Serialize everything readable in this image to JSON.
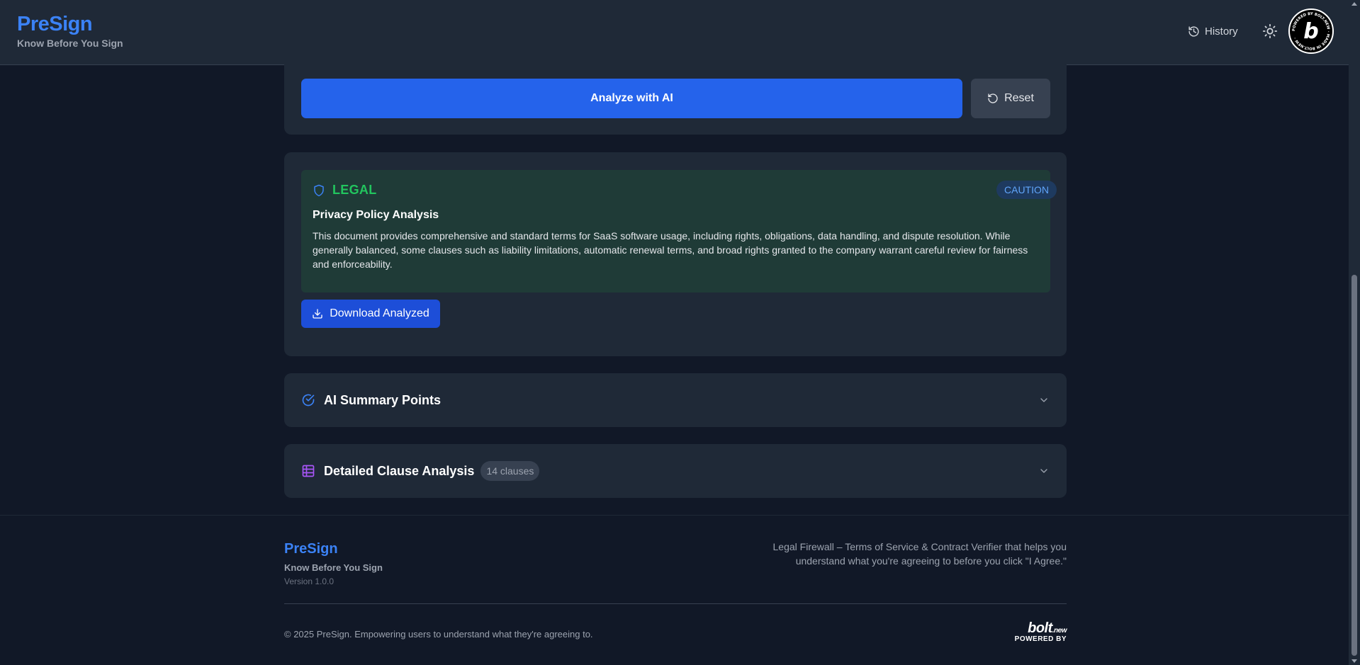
{
  "header": {
    "brand_title": "PreSign",
    "brand_tagline": "Know Before You Sign",
    "history_label": "History",
    "badge_letter": "b",
    "badge_ring_text": "POWERED BY BOLT.NEW · MADE IN BOLT.NEW ·"
  },
  "actions": {
    "analyze_label": "Analyze with AI",
    "reset_label": "Reset"
  },
  "result": {
    "category": "LEGAL",
    "risk_badge": "CAUTION",
    "title": "Privacy Policy Analysis",
    "body": "This document provides comprehensive and standard terms for SaaS software usage, including rights, obligations, data handling, and dispute resolution. While generally balanced, some clauses such as liability limitations, automatic renewal terms, and broad rights granted to the company warrant careful review for fairness and enforceability.",
    "download_label": "Download Analyzed"
  },
  "sections": {
    "summary_title": "AI Summary Points",
    "clauses_title": "Detailed Clause Analysis",
    "clauses_count": "14 clauses"
  },
  "footer": {
    "brand_title": "PreSign",
    "brand_tagline": "Know Before You Sign",
    "version": "Version 1.0.0",
    "description": "Legal Firewall – Terms of Service & Contract Verifier that helps you understand what you're agreeing to before you click \"I Agree.\"",
    "copyright": "© 2025 PreSign. Empowering users to understand what they're agreeing to.",
    "bolt_logo": "bolt",
    "bolt_logo_suffix": ".new",
    "bolt_powered": "POWERED BY"
  },
  "colors": {
    "accent": "#3b82f6",
    "primary_button": "#2563eb",
    "legal_green": "#22c55e",
    "caution_blue": "#60a5fa",
    "clauses_icon": "#a855f7"
  },
  "icons": {
    "history": "history-icon",
    "theme": "sun-icon",
    "reset": "rotate-ccw-icon",
    "legal": "shield-icon",
    "download": "download-icon",
    "summary": "check-circle-icon",
    "clauses": "table-icon",
    "chevron": "chevron-down-icon"
  }
}
